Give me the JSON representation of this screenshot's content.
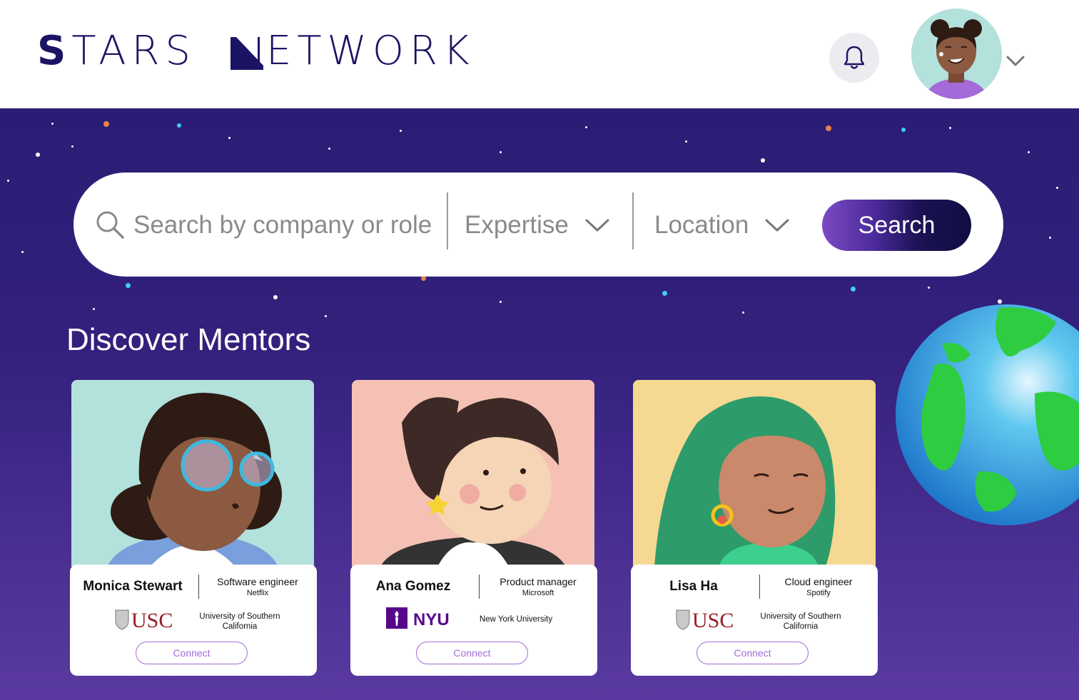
{
  "header": {
    "logo_text_1": "STARS",
    "logo_text_2": "ETWORK",
    "logo_aria": "STARS NETWORK",
    "icons": {
      "notifications": "bell-icon",
      "menu": "chevron-down-icon"
    }
  },
  "search": {
    "placeholder": "Search by company or role",
    "expertise_label": "Expertise",
    "location_label": "Location",
    "button_label": "Search"
  },
  "section": {
    "title": "Discover Mentors"
  },
  "mentors": [
    {
      "name": "Monica Stewart",
      "role": "Software engineer",
      "company": "Netflix",
      "school_logo": "USC",
      "school": "University of Southern California",
      "connect": "Connect",
      "bg": "#b3e1dc"
    },
    {
      "name": "Ana Gomez",
      "role": "Product manager",
      "company": "Microsoft",
      "school_logo": "NYU",
      "school": "New York University",
      "connect": "Connect",
      "bg": "#f5c1b5"
    },
    {
      "name": "Lisa Ha",
      "role": "Cloud engineer",
      "company": "Spotify",
      "school_logo": "USC",
      "school": "University of Southern California",
      "connect": "Connect",
      "bg": "#f5d892"
    }
  ],
  "colors": {
    "brand": "#1b1464",
    "accent": "#a46bd9",
    "usc": "#9b1c23",
    "nyu": "#57068c"
  }
}
